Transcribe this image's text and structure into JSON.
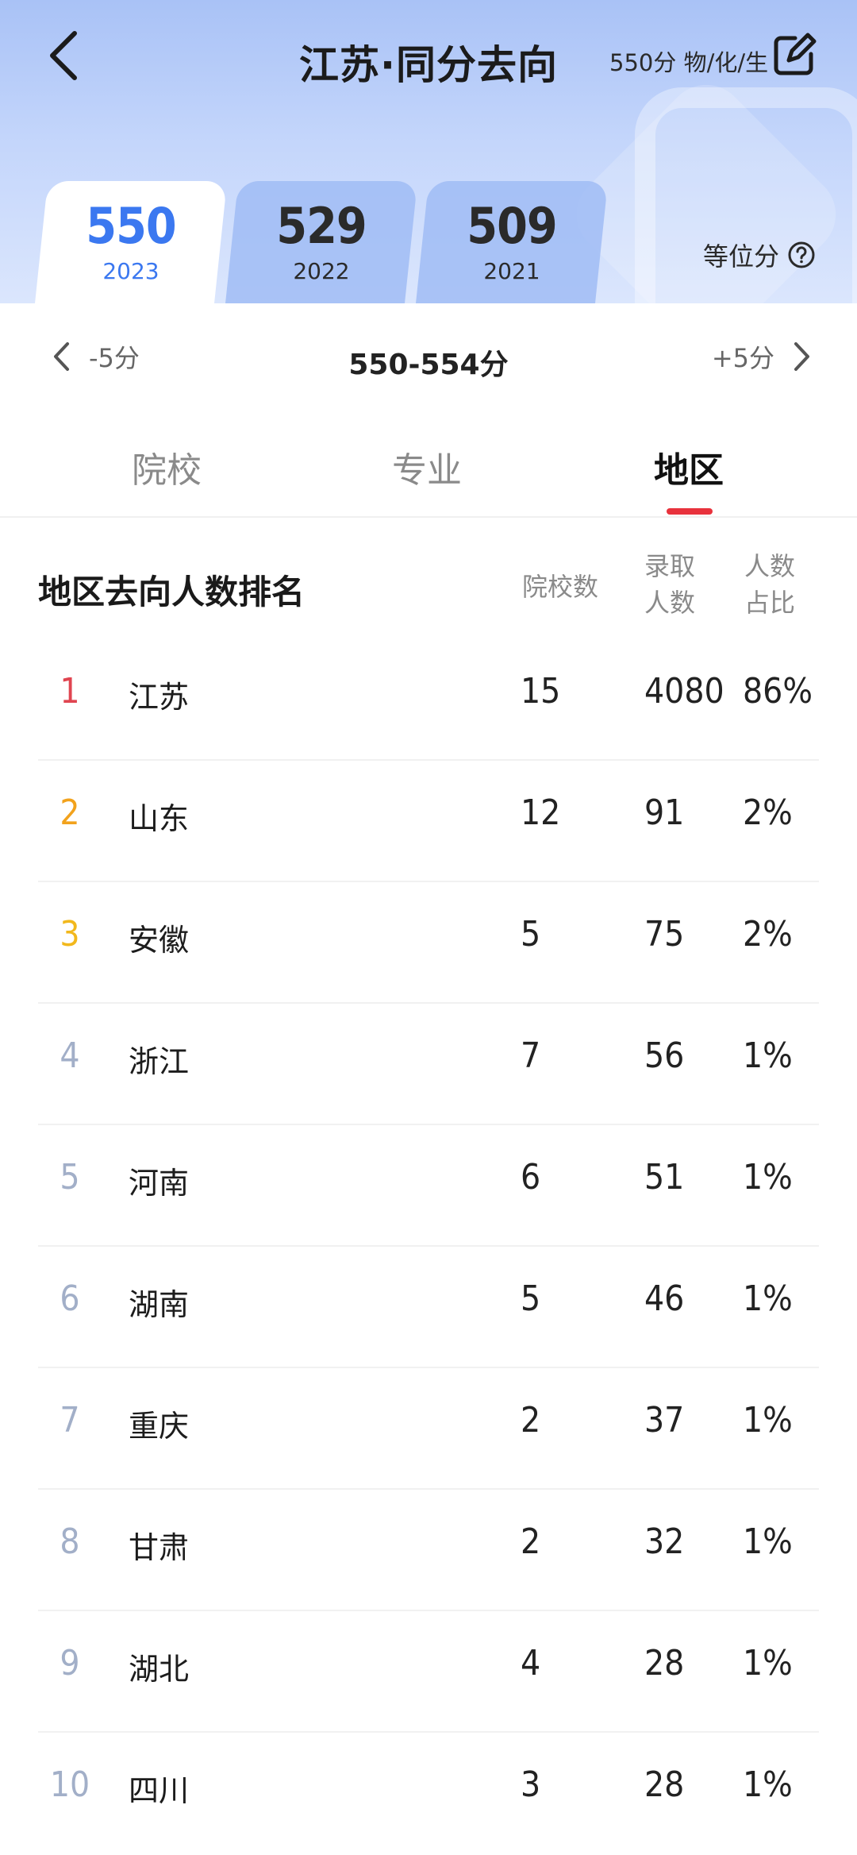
{
  "header": {
    "title": "江苏·同分去向",
    "score_info": "550分 物/化/生",
    "back_icon": "chevron-left-icon",
    "edit_icon": "edit-icon",
    "equal_score_label": "等位分",
    "help_icon": "question-circle-icon"
  },
  "year_tabs": [
    {
      "score": "550",
      "year": "2023",
      "active": true
    },
    {
      "score": "529",
      "year": "2022",
      "active": false
    },
    {
      "score": "509",
      "year": "2021",
      "active": false
    }
  ],
  "range": {
    "prev_label": "-5分",
    "current": "550-554分",
    "next_label": "+5分"
  },
  "category_tabs": [
    {
      "label": "院校",
      "active": false
    },
    {
      "label": "专业",
      "active": false
    },
    {
      "label": "地区",
      "active": true
    }
  ],
  "table": {
    "title": "地区去向人数排名",
    "col_schools": "院校数",
    "col_admit": "录取人数",
    "col_admit_lines": [
      "录取",
      "人数"
    ],
    "col_ratio_lines": [
      "人数",
      "占比"
    ],
    "rows": [
      {
        "rank": "1",
        "region": "江苏",
        "schools": "15",
        "admit": "4080",
        "ratio": "86%"
      },
      {
        "rank": "2",
        "region": "山东",
        "schools": "12",
        "admit": "91",
        "ratio": "2%"
      },
      {
        "rank": "3",
        "region": "安徽",
        "schools": "5",
        "admit": "75",
        "ratio": "2%"
      },
      {
        "rank": "4",
        "region": "浙江",
        "schools": "7",
        "admit": "56",
        "ratio": "1%"
      },
      {
        "rank": "5",
        "region": "河南",
        "schools": "6",
        "admit": "51",
        "ratio": "1%"
      },
      {
        "rank": "6",
        "region": "湖南",
        "schools": "5",
        "admit": "46",
        "ratio": "1%"
      },
      {
        "rank": "7",
        "region": "重庆",
        "schools": "2",
        "admit": "37",
        "ratio": "1%"
      },
      {
        "rank": "8",
        "region": "甘肃",
        "schools": "2",
        "admit": "32",
        "ratio": "1%"
      },
      {
        "rank": "9",
        "region": "湖北",
        "schools": "4",
        "admit": "28",
        "ratio": "1%"
      },
      {
        "rank": "10",
        "region": "四川",
        "schools": "3",
        "admit": "28",
        "ratio": "1%"
      }
    ]
  },
  "colors": {
    "accent_blue": "#3b78f0",
    "accent_red": "#e8323c",
    "rank1": "#e04550",
    "rank2": "#f2a21c",
    "rank3": "#f2b81c",
    "rank_other": "#a2afc8"
  }
}
